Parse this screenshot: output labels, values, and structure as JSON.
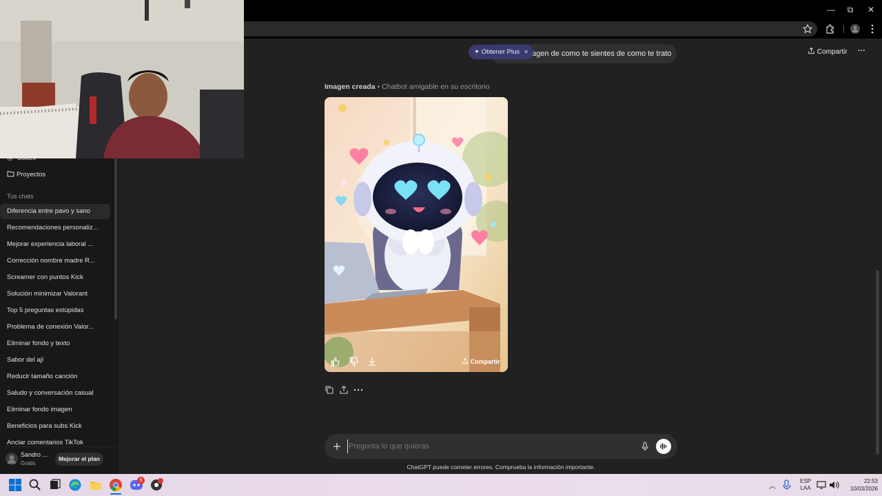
{
  "window": {
    "minimize": "—",
    "restore": "⧉",
    "close": "✕"
  },
  "header": {
    "plus_label": "Obtener Plus",
    "plus_close": "×",
    "user_message": "agen de como te sientes de como te trato",
    "share_label": "Compartir",
    "more": "···"
  },
  "sidebar": {
    "codex_label": "Codex",
    "projects_label": "Proyectos",
    "chats_heading": "Tus chats",
    "chats": [
      "Diferencia entre pavo y sano",
      "Recomendaciones personaliz...",
      "Mejorar experiencia laboral ...",
      "Corrección nombre madre R...",
      "Screamer con puntos Kick",
      "Solución minimizar Valorant",
      "Top 5 preguntas estúpidas",
      "Problema de conexión Valor...",
      "Eliminar fondo y texto",
      "Sabor del ají",
      "Reducir tamaño canción",
      "Saludo y conversación casual",
      "Eliminar fondo imagen",
      "Beneficios para subs Kick",
      "Anclar comentarios TikTok"
    ],
    "user_name": "Sandro ...",
    "user_plan": "Gratis",
    "upgrade_label": "Mejorar el plan"
  },
  "message": {
    "image_title": "Imagen creada",
    "image_separator": "•",
    "image_caption": "Chatbot amigable en su escritorio",
    "image_share_label": "Compartir"
  },
  "composer": {
    "placeholder": "Pregunta lo que quieras",
    "disclaimer": "ChatGPT puede cometer errores. Comprueba la información importante."
  },
  "taskbar": {
    "lang_top": "ESP",
    "lang_bottom": "LAA",
    "time": "22:53",
    "date": "10/03/2026",
    "discord_badge": "5"
  },
  "colors": {
    "bg": "#212121",
    "sidebar": "#181818",
    "accent": "#3b3a6e"
  }
}
